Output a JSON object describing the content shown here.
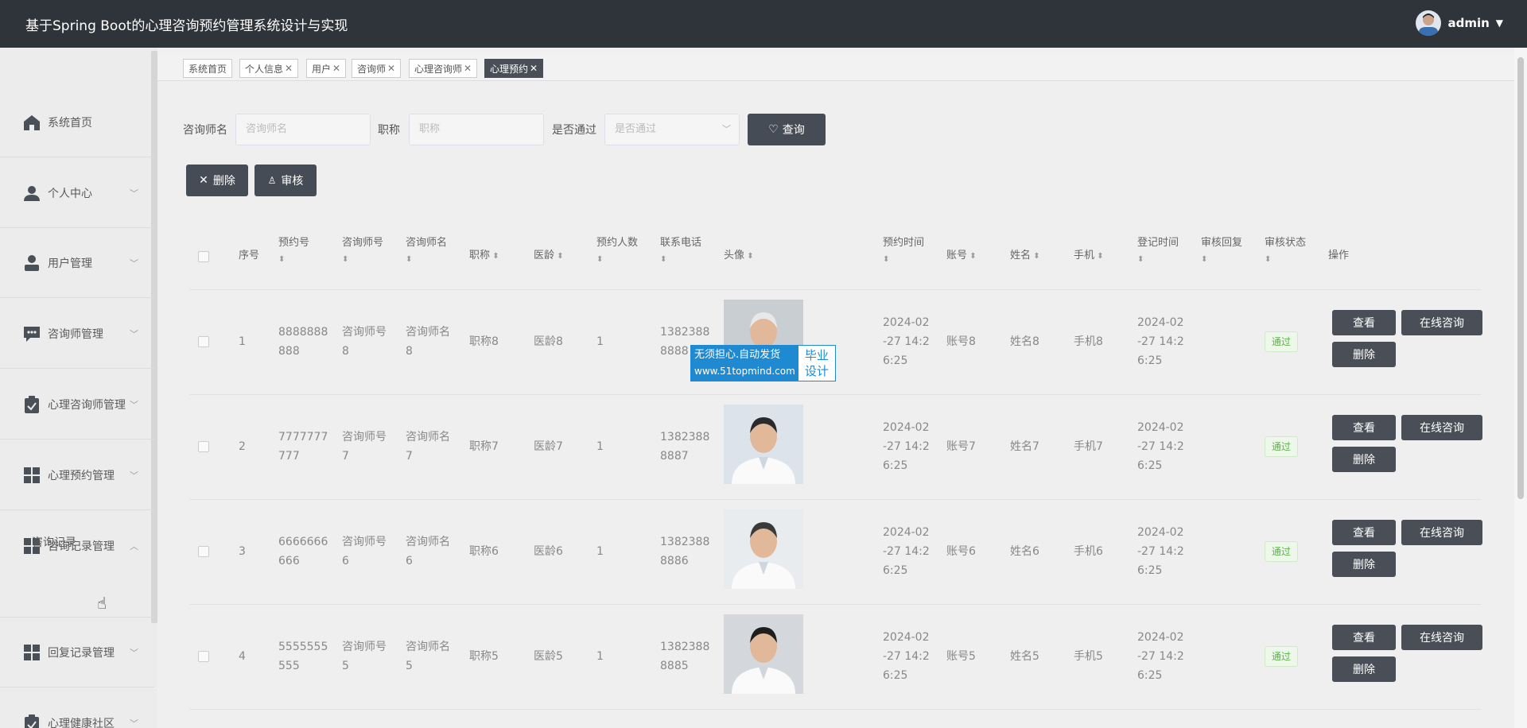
{
  "header": {
    "title": "基于Spring Boot的心理咨询预约管理系统设计与实现",
    "username": "admin"
  },
  "sidebar": {
    "items": [
      {
        "label": "系统首页",
        "icon": "home-icon"
      },
      {
        "label": "个人中心",
        "icon": "user-icon"
      },
      {
        "label": "用户管理",
        "icon": "user-manage-icon"
      },
      {
        "label": "咨询师管理",
        "icon": "chat-icon"
      },
      {
        "label": "心理咨询师管理",
        "icon": "clipboard-icon"
      },
      {
        "label": "心理预约管理",
        "icon": "grid-icon"
      },
      {
        "label": "咨询记录管理",
        "icon": "grid-icon"
      },
      {
        "label": "回复记录管理",
        "icon": "grid-icon"
      },
      {
        "label": "心理健康社区",
        "icon": "clipboard-icon"
      }
    ],
    "submenu_item": "咨询记录"
  },
  "tabs": [
    {
      "label": "系统首页",
      "closable": false
    },
    {
      "label": "个人信息",
      "closable": true
    },
    {
      "label": "用户",
      "closable": true
    },
    {
      "label": "咨询师",
      "closable": true
    },
    {
      "label": "心理咨询师",
      "closable": true
    },
    {
      "label": "心理预约",
      "closable": true,
      "active": true
    }
  ],
  "filters": {
    "name_label": "咨询师名",
    "name_placeholder": "咨询师名",
    "title_label": "职称",
    "title_placeholder": "职称",
    "approved_label": "是否通过",
    "approved_placeholder": "是否通过",
    "search_button": "查询"
  },
  "actions": {
    "delete_button": "删除",
    "review_button": "审核"
  },
  "table": {
    "headers": [
      "序号",
      "预约号",
      "咨询师号",
      "咨询师名",
      "职称",
      "医龄",
      "预约人数",
      "联系电话",
      "头像",
      "预约时间",
      "账号",
      "姓名",
      "手机",
      "登记时间",
      "审核回复",
      "审核状态",
      "操作"
    ],
    "rows": [
      {
        "index": "1",
        "booking_no": [
          "8888888",
          "888"
        ],
        "counselor_no": [
          "咨询师号",
          "8"
        ],
        "counselor_name": [
          "咨询师名",
          "8"
        ],
        "title": "职称8",
        "seniority": "医龄8",
        "count": "1",
        "phone": [
          "1382388",
          "8888"
        ],
        "booking_time": [
          "2024-02",
          "-27 14:2",
          "6:25"
        ],
        "account": "账号8",
        "name": "姓名8",
        "mobile": "手机8",
        "reg_time": [
          "2024-02",
          "-27 14:2",
          "6:25"
        ],
        "status": "通过"
      },
      {
        "index": "2",
        "booking_no": [
          "7777777",
          "777"
        ],
        "counselor_no": [
          "咨询师号",
          "7"
        ],
        "counselor_name": [
          "咨询师名",
          "7"
        ],
        "title": "职称7",
        "seniority": "医龄7",
        "count": "1",
        "phone": [
          "1382388",
          "8887"
        ],
        "booking_time": [
          "2024-02",
          "-27 14:2",
          "6:25"
        ],
        "account": "账号7",
        "name": "姓名7",
        "mobile": "手机7",
        "reg_time": [
          "2024-02",
          "-27 14:2",
          "6:25"
        ],
        "status": "通过"
      },
      {
        "index": "3",
        "booking_no": [
          "6666666",
          "666"
        ],
        "counselor_no": [
          "咨询师号",
          "6"
        ],
        "counselor_name": [
          "咨询师名",
          "6"
        ],
        "title": "职称6",
        "seniority": "医龄6",
        "count": "1",
        "phone": [
          "1382388",
          "8886"
        ],
        "booking_time": [
          "2024-02",
          "-27 14:2",
          "6:25"
        ],
        "account": "账号6",
        "name": "姓名6",
        "mobile": "手机6",
        "reg_time": [
          "2024-02",
          "-27 14:2",
          "6:25"
        ],
        "status": "通过"
      },
      {
        "index": "4",
        "booking_no": [
          "5555555",
          "555"
        ],
        "counselor_no": [
          "咨询师号",
          "5"
        ],
        "counselor_name": [
          "咨询师名",
          "5"
        ],
        "title": "职称5",
        "seniority": "医龄5",
        "count": "1",
        "phone": [
          "1382388",
          "8885"
        ],
        "booking_time": [
          "2024-02",
          "-27 14:2",
          "6:25"
        ],
        "account": "账号5",
        "name": "姓名5",
        "mobile": "手机5",
        "reg_time": [
          "2024-02",
          "-27 14:2",
          "6:25"
        ],
        "status": "通过"
      }
    ],
    "row_actions": {
      "view": "查看",
      "online_consult": "在线咨询",
      "delete": "删除"
    }
  },
  "watermark": {
    "line1": "无须担心.自动发货",
    "line2": "www.51topmind.com",
    "right1": "毕业",
    "right2": "设计"
  },
  "colors": {
    "header_bg": "#2f343b",
    "button_dark": "#464c55",
    "status_green": "#5bb14a"
  }
}
